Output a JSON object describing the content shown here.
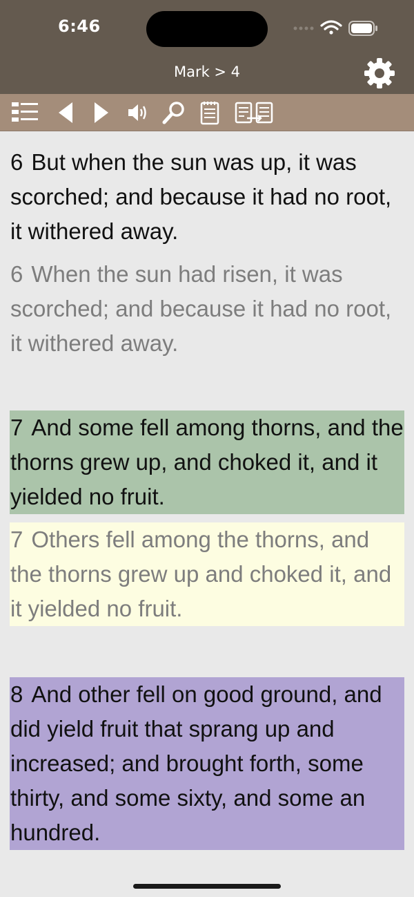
{
  "status_bar": {
    "time": "6:46",
    "icons": [
      "signal-dots-icon",
      "wifi-icon",
      "battery-icon"
    ]
  },
  "header": {
    "title": "Mark > 4",
    "settings_icon": "gear-icon"
  },
  "toolbar": {
    "buttons": [
      {
        "name": "list-icon"
      },
      {
        "name": "previous-icon"
      },
      {
        "name": "next-icon"
      },
      {
        "name": "speaker-icon"
      },
      {
        "name": "search-icon"
      },
      {
        "name": "notes-icon"
      },
      {
        "name": "compare-icon"
      }
    ]
  },
  "colors": {
    "header_bg": "#645a4f",
    "toolbar_bg": "#a48d7a",
    "page_bg": "#e9e9e9",
    "highlight_green": "#abc4aa",
    "highlight_yellow": "#fdfde1",
    "highlight_purple": "#b1a4d3"
  },
  "verses": [
    {
      "number": "6",
      "text": "But when the sun was up, it was scorched; and because it had no root, it withered away.",
      "style": "kjv",
      "highlight": null
    },
    {
      "number": "6",
      "text": "When the sun had risen, it was scorched; and because it had no root, it withered away.",
      "style": "modern",
      "highlight": null
    },
    {
      "number": "7",
      "text": "And some fell among thorns, and the thorns grew up, and choked it, and it yielded no fruit.",
      "style": "kjv",
      "highlight": "#abc4aa"
    },
    {
      "number": "7",
      "text": "Others fell among the thorns, and the thorns grew up and choked it, and it yielded no fruit.",
      "style": "modern",
      "highlight": "#fdfde1"
    },
    {
      "number": "8",
      "text": "And other fell on good ground, and did yield fruit that sprang up and increased; and brought forth, some thirty, and some sixty, and some an hundred.",
      "style": "kjv",
      "highlight": "#b1a4d3"
    }
  ]
}
